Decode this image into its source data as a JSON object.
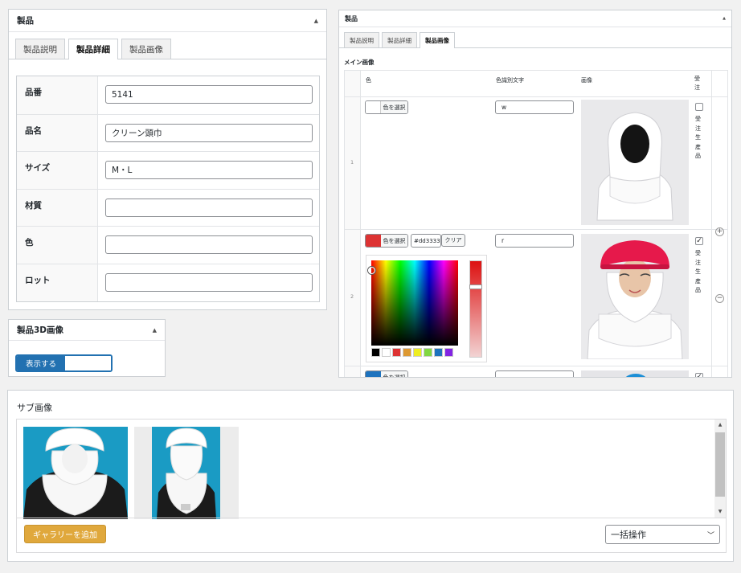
{
  "product_panel": {
    "title": "製品",
    "tabs": [
      "製品説明",
      "製品詳細",
      "製品画像"
    ],
    "fields": [
      {
        "label": "品番",
        "value": "5141"
      },
      {
        "label": "品名",
        "value": "クリーン頭巾"
      },
      {
        "label": "サイズ",
        "value": "M・L"
      },
      {
        "label": "材質",
        "value": ""
      },
      {
        "label": "色",
        "value": ""
      },
      {
        "label": "ロット",
        "value": ""
      }
    ]
  },
  "panel3d": {
    "title": "製品3D画像",
    "toggle_label": "表示する"
  },
  "right_panel": {
    "title": "製品",
    "tabs": [
      "製品説明",
      "製品詳細",
      "製品画像"
    ],
    "section_label": "メイン画像",
    "columns": {
      "color": "色",
      "color_text": "色識別文字",
      "image": "画像",
      "order": "受注"
    },
    "rows": [
      {
        "num": "1",
        "color_text": "w",
        "swatch": "#ffffff",
        "checked": false
      },
      {
        "num": "2",
        "color_text": "r",
        "swatch": "#dd3333",
        "checked": true
      }
    ],
    "select_color_label": "色を選択",
    "hex_value": "#dd3333",
    "clear_label": "クリア",
    "order_label": "受注生産品",
    "row3_swatch": "#1e73be",
    "palette": [
      "#000000",
      "#ffffff",
      "#dd3333",
      "#dd9933",
      "#eeee22",
      "#81d742",
      "#1e73be",
      "#8224e3"
    ]
  },
  "sub_images": {
    "title": "サブ画像",
    "add_gallery_label": "ギャラリーを追加",
    "bulk_action": "一括操作"
  },
  "colors": {
    "accent": "#2271b1",
    "gallery_button": "#e0a83c",
    "sub_bg": "#1a9bc4"
  }
}
